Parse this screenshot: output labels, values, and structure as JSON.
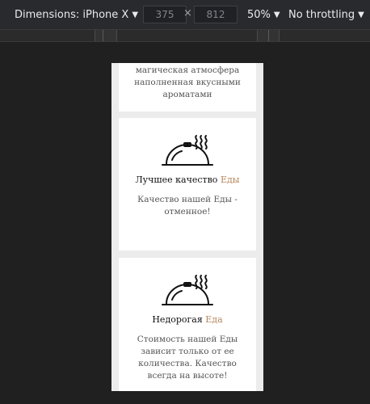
{
  "toolbar": {
    "device_label": "Dimensions: iPhone X",
    "width_value": "375",
    "height_value": "812",
    "separator": "×",
    "zoom": "50%",
    "throttling": "No throttling"
  },
  "page": {
    "cards": [
      {
        "text": "магическая атмосфера наполненная вкусными ароматами"
      },
      {
        "title": "Лучшее качество",
        "title_accent": "Еды",
        "text": "Качество нашей Еды - отменное!",
        "icon": "food-cloche-icon"
      },
      {
        "title": "Недорогая",
        "title_accent": "Еда",
        "text": "Стоимость нашей Еды зависит только от ее количества. Качество всегда на высоте!",
        "icon": "food-cloche-icon"
      }
    ],
    "accent_color": "#b5875c"
  }
}
